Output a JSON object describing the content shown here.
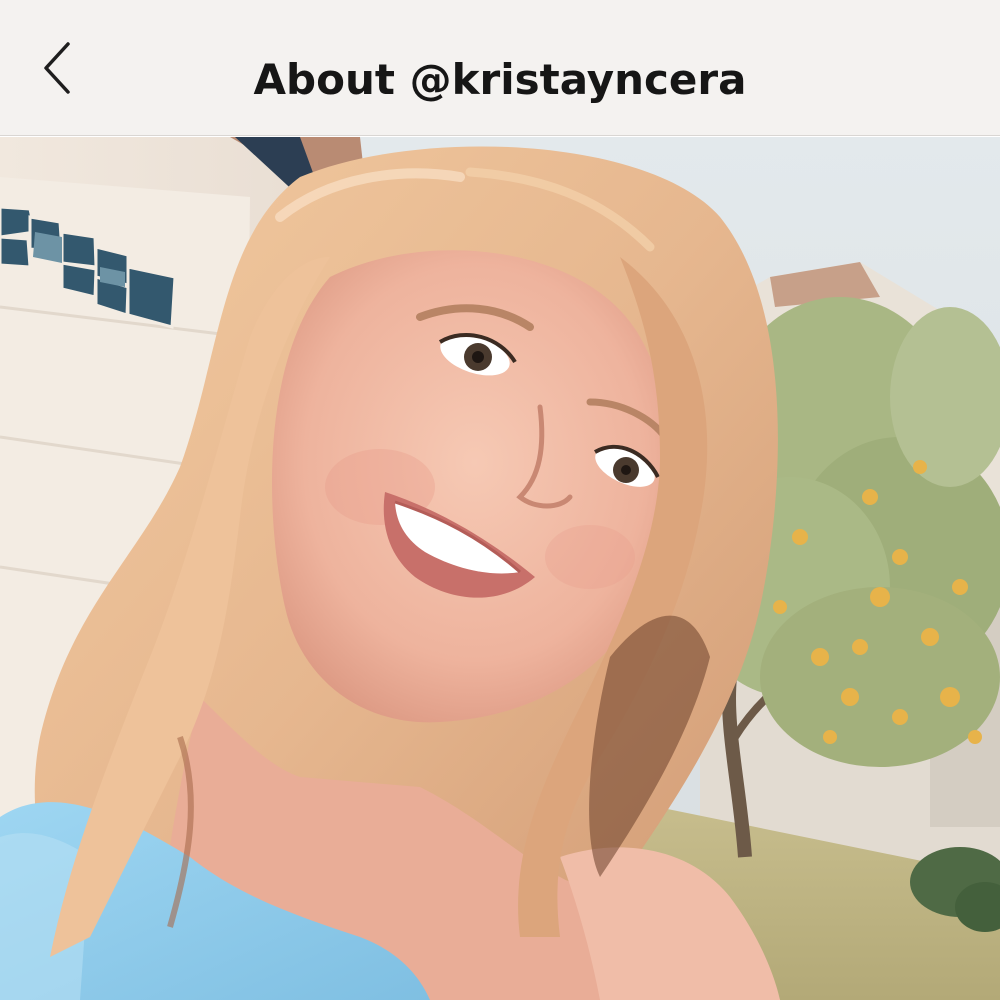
{
  "nav": {
    "back_icon": "chevron-left-icon",
    "title": "About @kristayncera"
  },
  "photo": {
    "kind": "profile-photo"
  },
  "colors": {
    "nav_background": "#f4f2f0",
    "title_text": "#161616",
    "hair": "#e6b78f",
    "sky": "#dfe6ea",
    "top_garment": "#8ecbea"
  }
}
